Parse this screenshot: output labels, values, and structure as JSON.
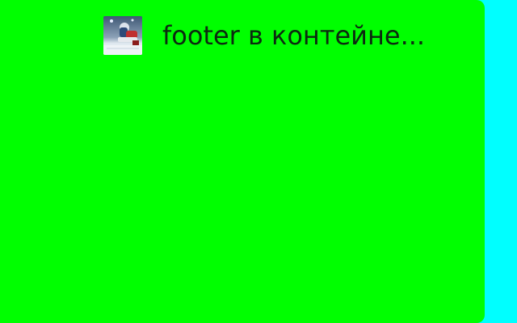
{
  "card": {
    "title": "footer в контейне...",
    "thumbnail_icon": "hockey-photo-thumbnail",
    "background_color": "#00ff00"
  },
  "page": {
    "background_color": "#00ffff"
  }
}
